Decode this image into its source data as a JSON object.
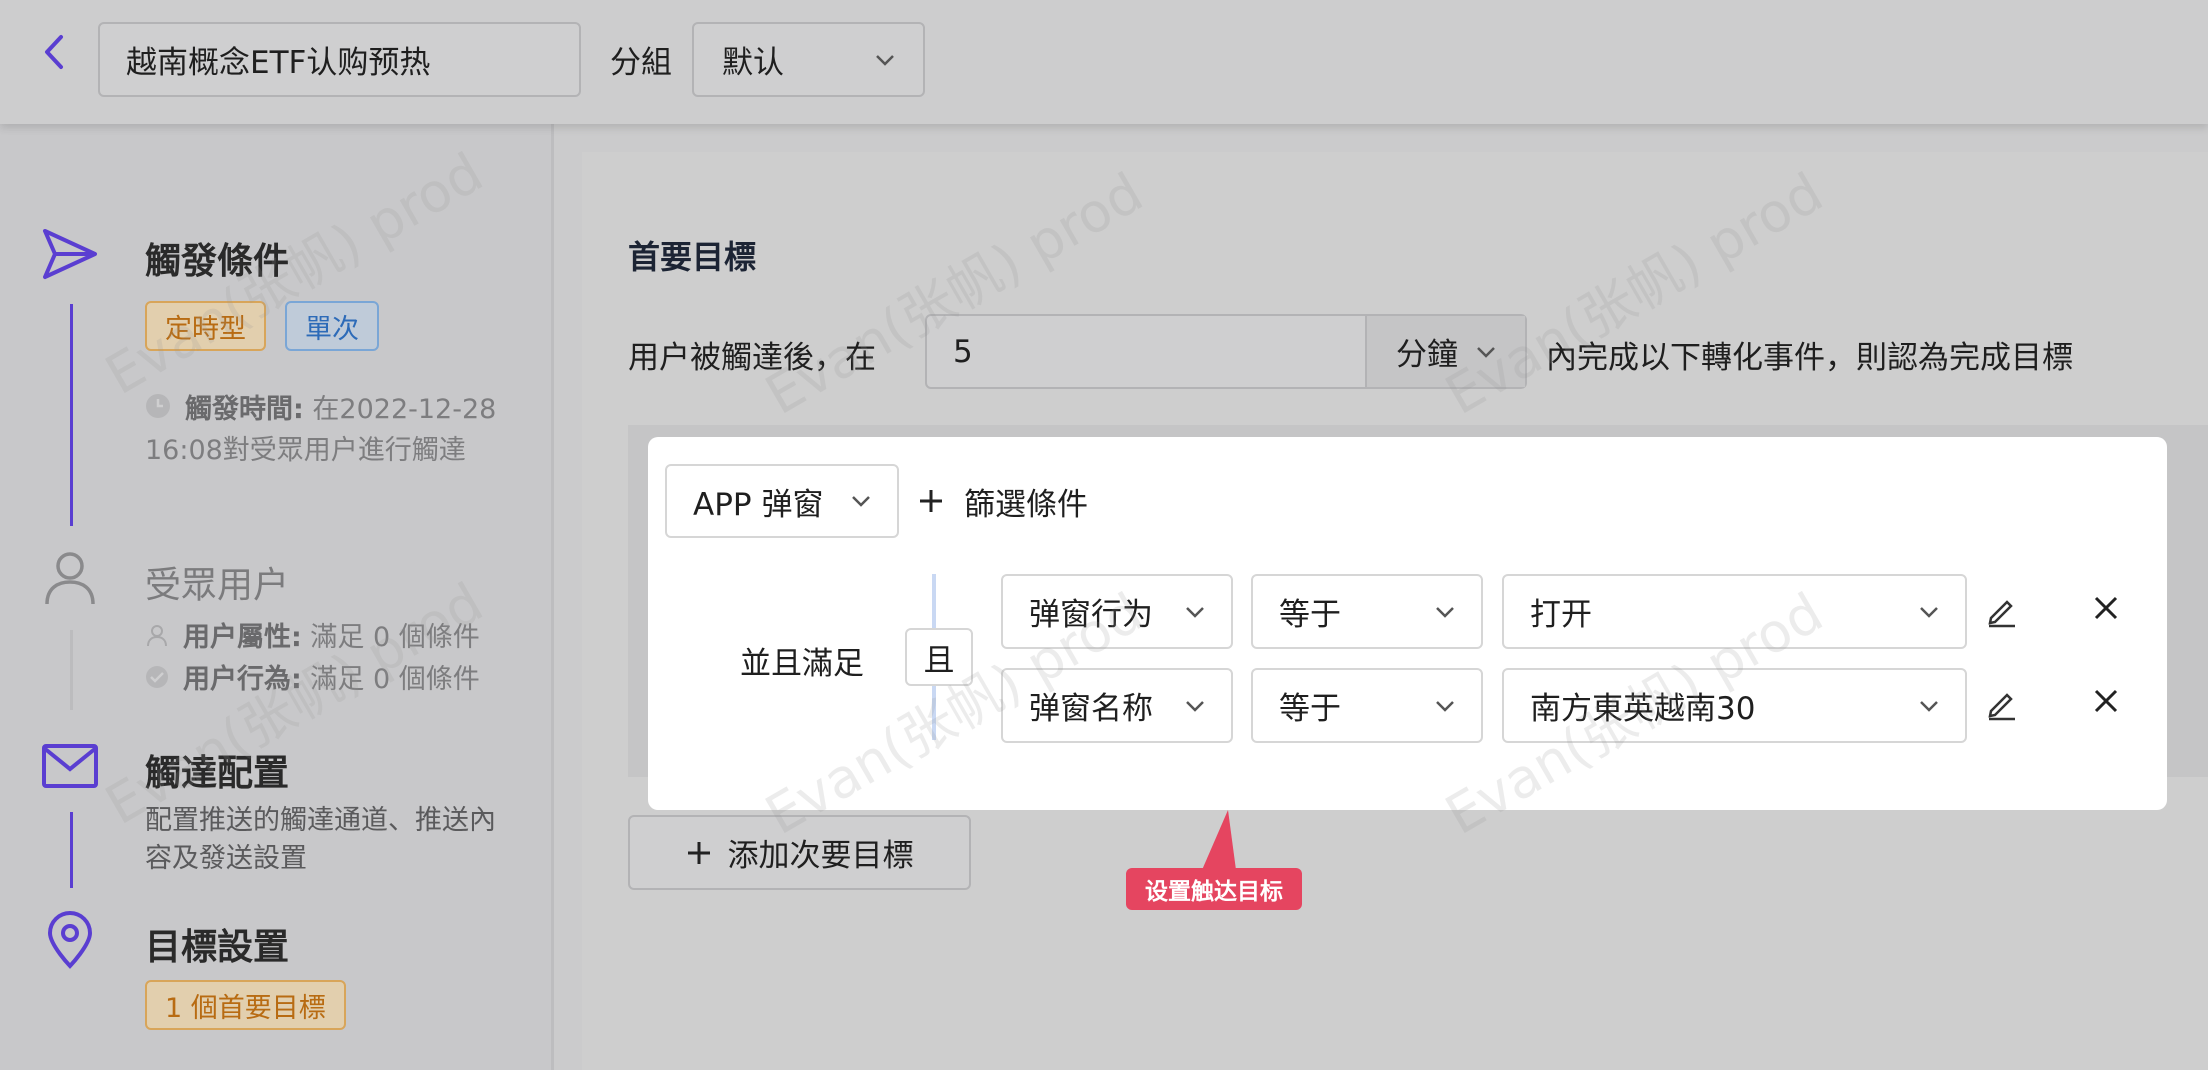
{
  "header": {
    "activity_name": "越南概念ETF认购预热",
    "group_label": "分組",
    "group_value": "默认"
  },
  "sidebar": {
    "steps": [
      {
        "title": "觸發條件",
        "tags": [
          "定時型",
          "單次"
        ],
        "meta_label": "觸發時間:",
        "meta_value": "在2022-12-28 16:08對受眾用户進行觸達"
      },
      {
        "title": "受眾用户",
        "lines": [
          {
            "label": "用户屬性:",
            "value": "滿足 0 個條件"
          },
          {
            "label": "用户行為:",
            "value": "滿足 0 個條件"
          }
        ]
      },
      {
        "title": "觸達配置",
        "desc": "配置推送的觸達通道、推送內容及發送設置"
      },
      {
        "title": "目標設置",
        "tag": "1 個首要目標"
      }
    ]
  },
  "main": {
    "section_title": "首要目標",
    "sentence_prefix": "用户被觸達後，在",
    "minutes_value": "5",
    "minutes_unit": "分鐘",
    "sentence_suffix": "內完成以下轉化事件，則認為完成目標",
    "event_select": "APP 弹窗",
    "add_filter": "篩選條件",
    "and_label": "並且滿足",
    "and_badge": "且",
    "conditions": [
      {
        "field": "弹窗行为",
        "op": "等于",
        "value": "打开"
      },
      {
        "field": "弹窗名称",
        "op": "等于",
        "value": "南方東英越南30"
      }
    ],
    "add_secondary": "添加次要目標"
  },
  "tooltip": "设置触达目标",
  "watermark": "Evan(张帆)  prod",
  "colors": {
    "accent": "#5a3ed1",
    "tooltip": "#e54560",
    "tag_orange": "#b86b12",
    "tag_blue": "#2d6bb8"
  }
}
